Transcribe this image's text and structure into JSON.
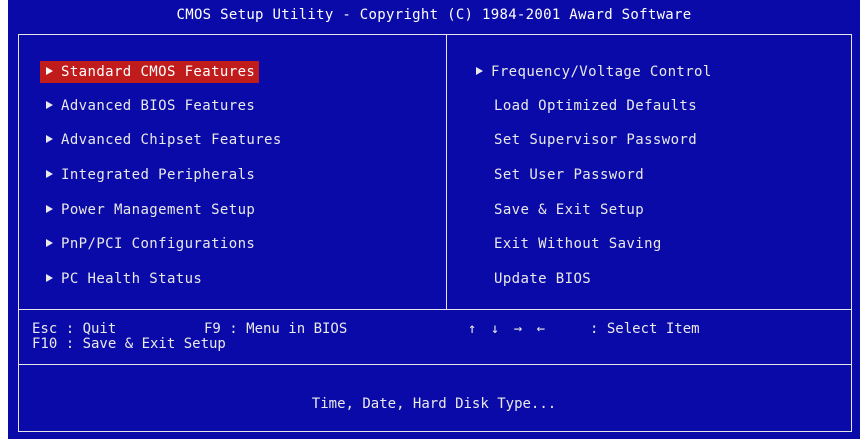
{
  "title": "CMOS Setup Utility - Copyright (C) 1984-2001 Award Software",
  "left_menu": [
    {
      "label": "Standard CMOS Features",
      "arrow": true,
      "selected": true
    },
    {
      "label": "Advanced BIOS Features",
      "arrow": true
    },
    {
      "label": "Advanced Chipset Features",
      "arrow": true
    },
    {
      "label": "Integrated Peripherals",
      "arrow": true
    },
    {
      "label": "Power Management Setup",
      "arrow": true
    },
    {
      "label": "PnP/PCI Configurations",
      "arrow": true
    },
    {
      "label": "PC Health Status",
      "arrow": true
    }
  ],
  "right_menu": [
    {
      "label": "Frequency/Voltage Control",
      "arrow": true
    },
    {
      "label": "Load Optimized Defaults",
      "arrow": false
    },
    {
      "label": "Set Supervisor Password",
      "arrow": false
    },
    {
      "label": "Set User Password",
      "arrow": false
    },
    {
      "label": "Save & Exit Setup",
      "arrow": false
    },
    {
      "label": "Exit Without Saving",
      "arrow": false
    },
    {
      "label": "Update BIOS",
      "arrow": false
    }
  ],
  "hints": {
    "esc": "Esc : Quit",
    "f9": "F9 : Menu in BIOS",
    "f10": "F10 : Save & Exit Setup",
    "arrows": "↑ ↓ → ←",
    "select": ": Select Item"
  },
  "help_text": "Time, Date, Hard Disk Type...",
  "colors": {
    "background": "#0a0aa8",
    "highlight": "#c01c1c",
    "text": "#e9e9e9"
  }
}
